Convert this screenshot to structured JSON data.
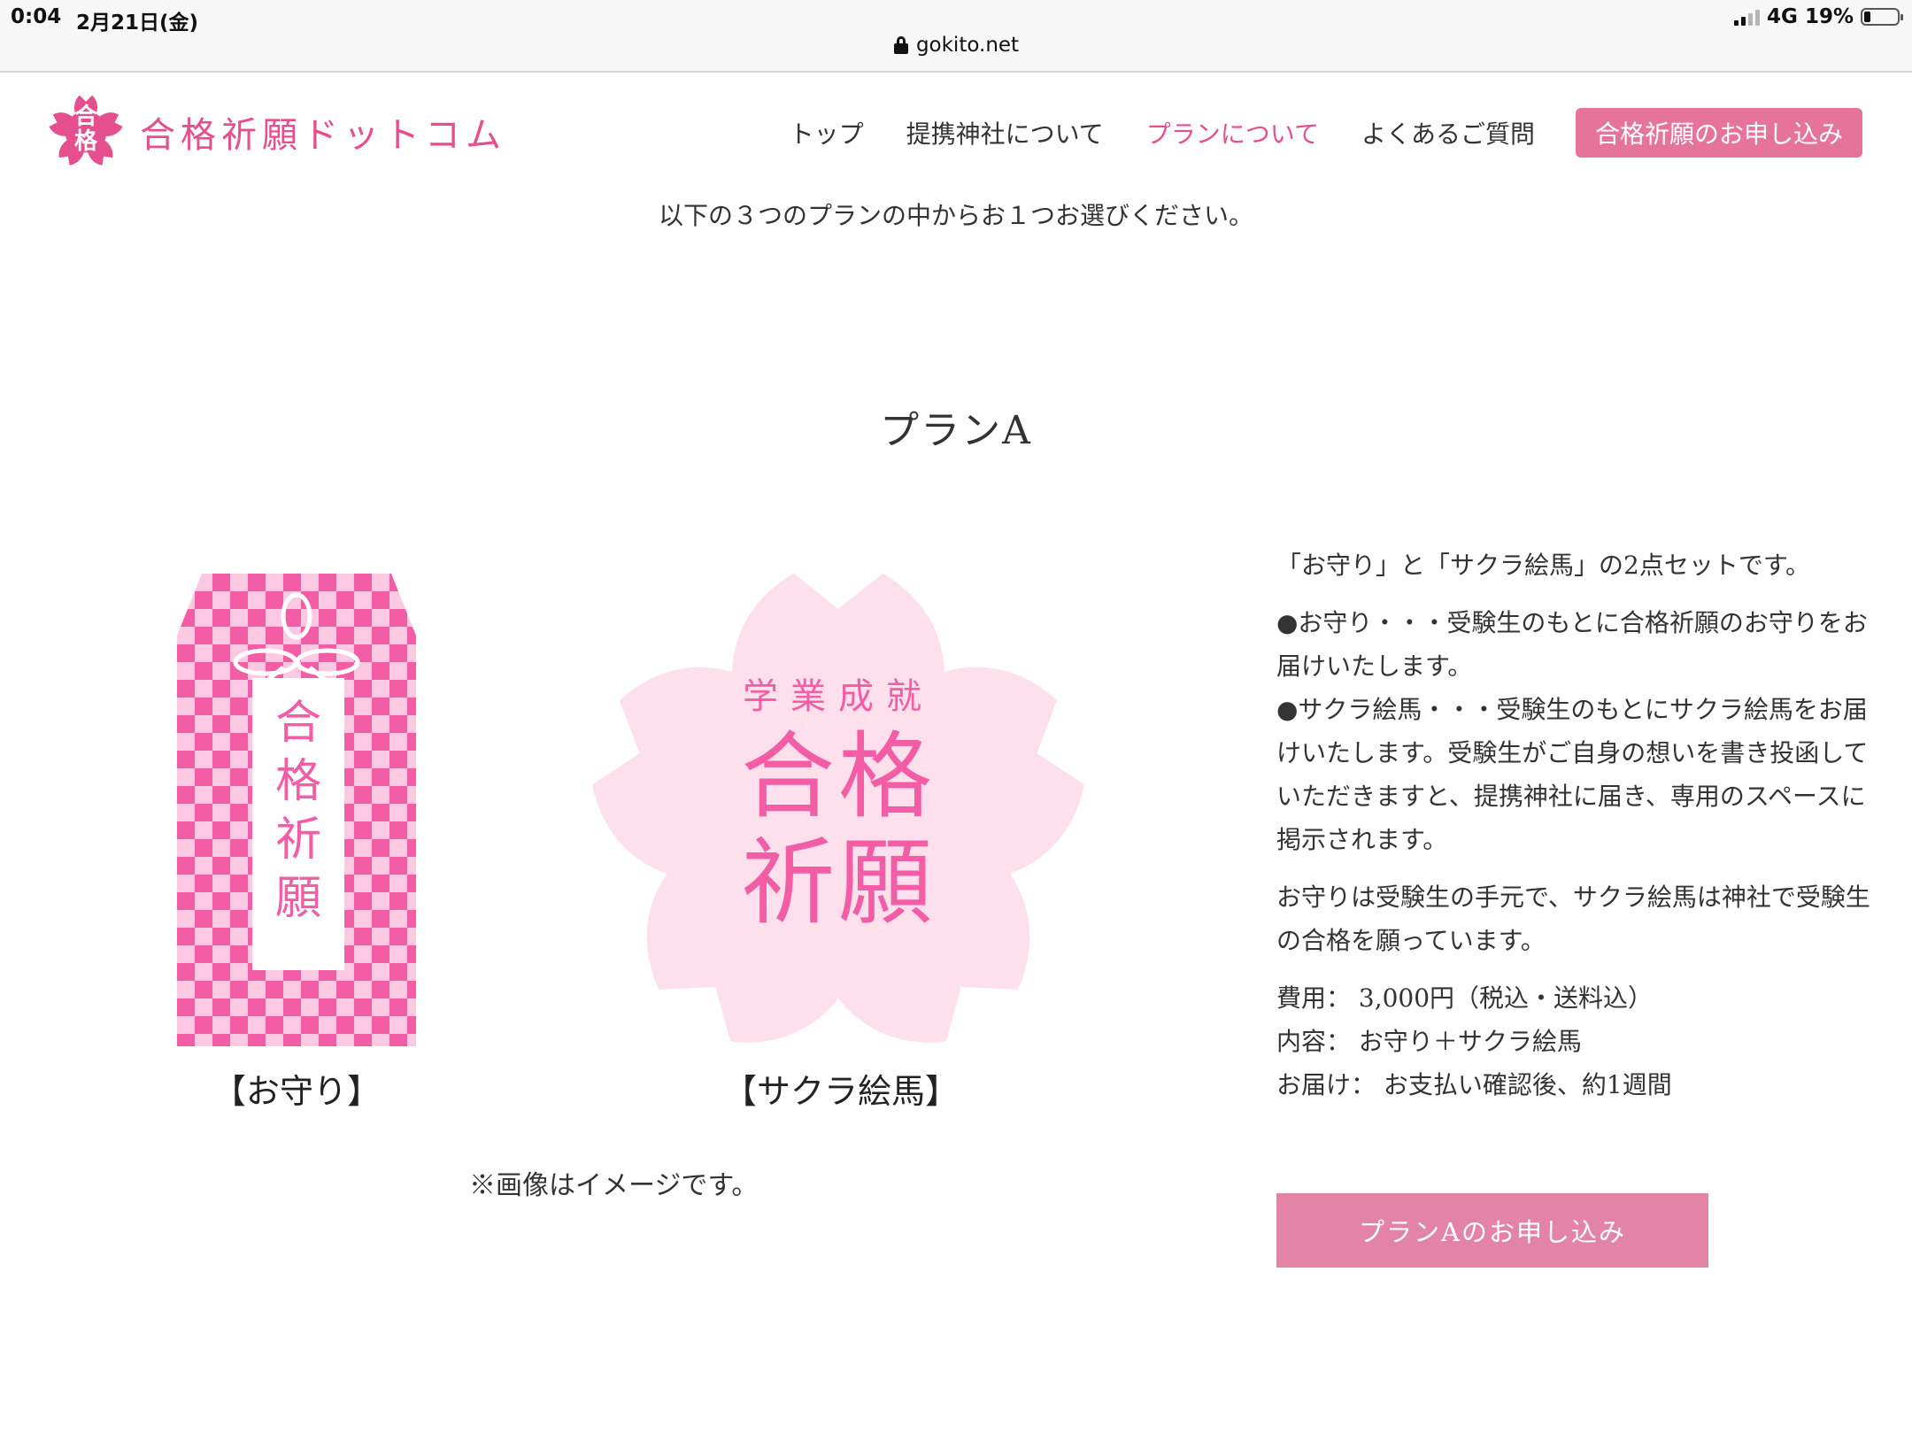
{
  "status_bar": {
    "time": "0:04",
    "date": "2月21日(金)",
    "network": "4G",
    "battery": "19%",
    "battery_level": 0.19,
    "url": "gokito.net"
  },
  "header": {
    "logo_mark_line1": "合",
    "logo_mark_line2": "格",
    "site_name": "合格祈願ドットコム",
    "nav": [
      {
        "label": "トップ"
      },
      {
        "label": "提携神社について"
      },
      {
        "label": "プランについて"
      },
      {
        "label": "よくあるご質問"
      }
    ],
    "cta_label": "合格祈願のお申し込み"
  },
  "intro": "以下の３つのプランの中からお１つお選びください。",
  "plan": {
    "title": "プランA",
    "omamori_text": [
      "合",
      "格",
      "祈",
      "願"
    ],
    "ema_subtitle": "学業成就",
    "ema_line1": "合格",
    "ema_line2": "祈願",
    "caption_omamori": "【お守り】",
    "caption_ema": "【サクラ絵馬】",
    "image_note": "※画像はイメージです。",
    "description": {
      "lead": "「お守り」と「サクラ絵馬」の2点セットです。",
      "item1": "●お守り・・・受験生のもとに合格祈願のお守りをお届けいたします。",
      "item2": "●サクラ絵馬・・・受験生のもとにサクラ絵馬をお届けいたします。受験生がご自身の想いを書き投函していただきますと、提携神社に届き、専用のスペースに掲示されます。",
      "summary": "お守りは受験生の手元で、サクラ絵馬は神社で受験生の合格を願っています。",
      "cost": "費用： 3,000円（税込・送料込）",
      "contents": "内容： お守り＋サクラ絵馬",
      "delivery": "お届け： お支払い確認後、約1週間"
    },
    "apply_label": "プランAのお申し込み"
  },
  "colors": {
    "accent": "#e64f8d",
    "button": "#e384a6",
    "sakura_light": "#fde0ec",
    "checker_dark": "#f25da5",
    "checker_light": "#fdc8e2"
  }
}
